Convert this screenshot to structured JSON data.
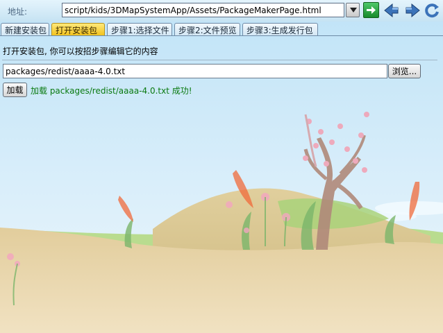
{
  "address_bar": {
    "label": "地址:",
    "url": "script/kids/3DMapSystemApp/Assets/PackageMakerPage.html"
  },
  "nav_icons": [
    "go-arrow-icon",
    "back-arrow-icon",
    "forward-arrow-icon",
    "refresh-icon"
  ],
  "tabs": [
    {
      "label": "新建安装包",
      "active": false
    },
    {
      "label": "打开安装包",
      "active": true
    },
    {
      "label": "步骤1:选择文件",
      "active": false
    },
    {
      "label": "步骤2:文件预览",
      "active": false
    },
    {
      "label": "步骤3:生成发行包",
      "active": false
    }
  ],
  "main": {
    "instruction": "打开安装包, 你可以按招步骤编辑它的内容",
    "file_path": "packages/redist/aaaa-4.0.txt",
    "browse_label": "浏览...",
    "load_label": "加载",
    "status": "加载 packages/redist/aaaa-4.0.txt 成功!"
  },
  "colors": {
    "accent_tab": "#f2c21e",
    "status_text": "#0a7a10",
    "go_button": "#178a2c"
  }
}
